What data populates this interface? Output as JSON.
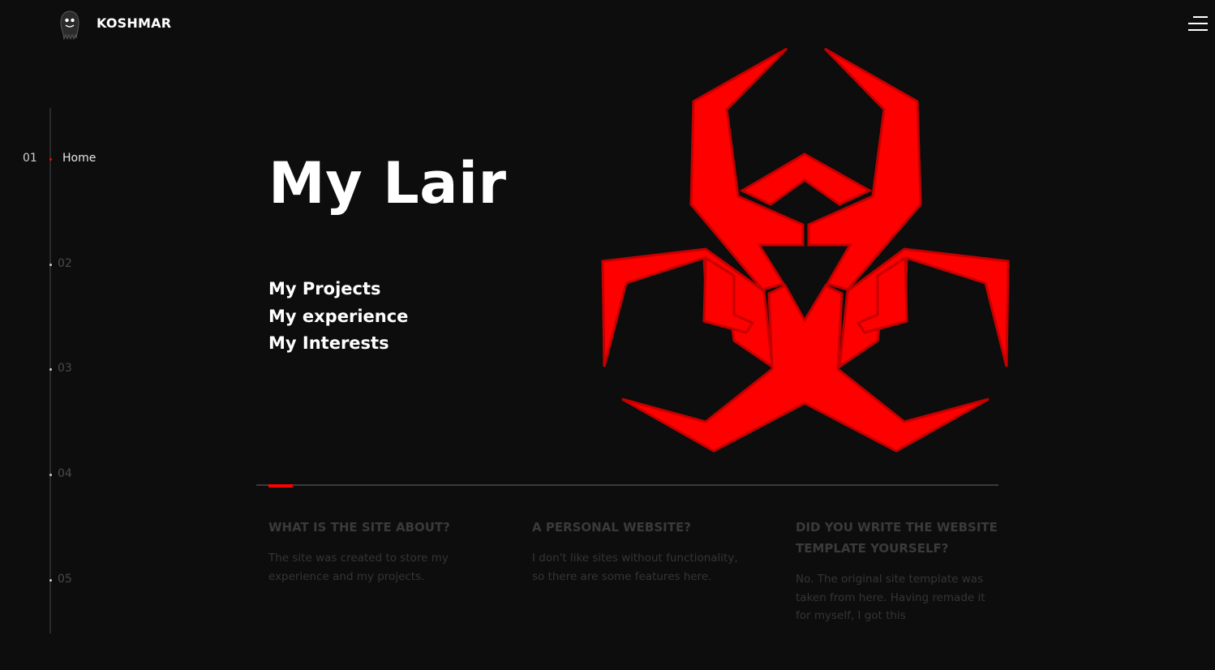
{
  "header": {
    "brand": "KOSHMAR"
  },
  "side_nav": {
    "items": [
      {
        "number": "01",
        "label": "Home",
        "active": true
      },
      {
        "number": "02",
        "label": "",
        "active": false
      },
      {
        "number": "03",
        "label": "",
        "active": false
      },
      {
        "number": "04",
        "label": "",
        "active": false
      },
      {
        "number": "05",
        "label": "",
        "active": false
      }
    ]
  },
  "hero": {
    "title": "My Lair",
    "links": [
      "My Projects",
      "My experience",
      "My Interests"
    ]
  },
  "info": [
    {
      "title": "WHAT IS THE SITE ABOUT?",
      "text": "The site was created to store my experience and my projects."
    },
    {
      "title": "A PERSONAL WEBSITE?",
      "text": "I don't like sites without functionality, so there are some features here."
    },
    {
      "title": "DID YOU WRITE THE WEBSITE TEMPLATE YOURSELF?",
      "text": "No. The original site template was taken from here. Having remade it for myself, I got this"
    }
  ],
  "colors": {
    "background": "#0d0d0d",
    "accent": "#ff0000",
    "biohazard_fill": "#ff0000",
    "biohazard_stroke": "#c40000"
  },
  "icons": {
    "logo": "ghost-avatar-icon",
    "menu": "hamburger-menu-icon",
    "emblem": "biohazard-icon"
  }
}
